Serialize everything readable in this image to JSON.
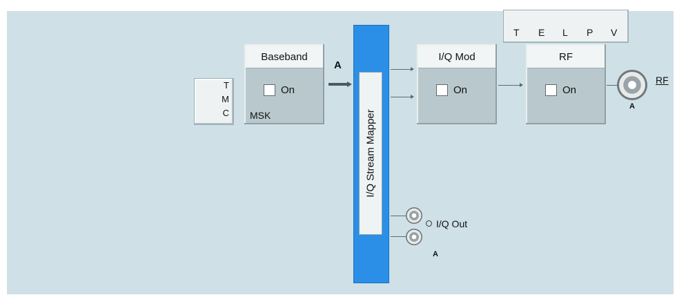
{
  "status_bar": {
    "letters": [
      "T",
      "E",
      "L",
      "P",
      "V"
    ]
  },
  "tmc": {
    "letters": [
      "T",
      "M",
      "C"
    ]
  },
  "baseband": {
    "title": "Baseband",
    "on_label": "On",
    "on_checked": false,
    "modulation": "MSK"
  },
  "path_label": "A",
  "stream_mapper": {
    "label": "I/Q Stream Mapper"
  },
  "iq_mod": {
    "title": "I/Q Mod",
    "on_label": "On",
    "on_checked": false
  },
  "rf_block": {
    "title": "RF",
    "on_label": "On",
    "on_checked": false
  },
  "rf_output": {
    "label": "RF",
    "path": "A"
  },
  "iq_out": {
    "label": "I/Q Out",
    "path": "A"
  }
}
